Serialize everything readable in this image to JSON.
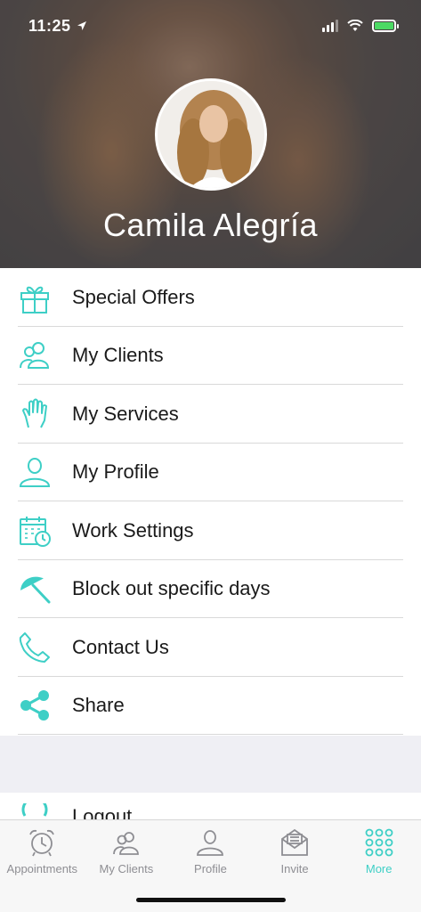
{
  "status_bar": {
    "time": "11:25"
  },
  "profile": {
    "name": "Camila  Alegría"
  },
  "menu": {
    "items": [
      {
        "label": "Special Offers",
        "icon": "gift-icon"
      },
      {
        "label": "My Clients",
        "icon": "clients-icon"
      },
      {
        "label": "My Services",
        "icon": "hand-icon"
      },
      {
        "label": "My Profile",
        "icon": "person-icon"
      },
      {
        "label": "Work Settings",
        "icon": "calendar-clock-icon"
      },
      {
        "label": "Block out specific days",
        "icon": "umbrella-icon"
      },
      {
        "label": "Contact Us",
        "icon": "phone-icon"
      },
      {
        "label": "Share",
        "icon": "share-icon"
      }
    ],
    "logout_label": "Logout"
  },
  "tab_bar": {
    "tabs": [
      {
        "label": "Appointments",
        "icon": "alarm-clock-icon"
      },
      {
        "label": "My Clients",
        "icon": "clients-icon"
      },
      {
        "label": "Profile",
        "icon": "person-icon"
      },
      {
        "label": "Invite",
        "icon": "envelope-icon"
      },
      {
        "label": "More",
        "icon": "grid-dots-icon"
      }
    ],
    "active": "More"
  },
  "colors": {
    "accent": "#3ecfc6",
    "inactive": "#8e8e93",
    "separator": "#d9d9d9"
  }
}
